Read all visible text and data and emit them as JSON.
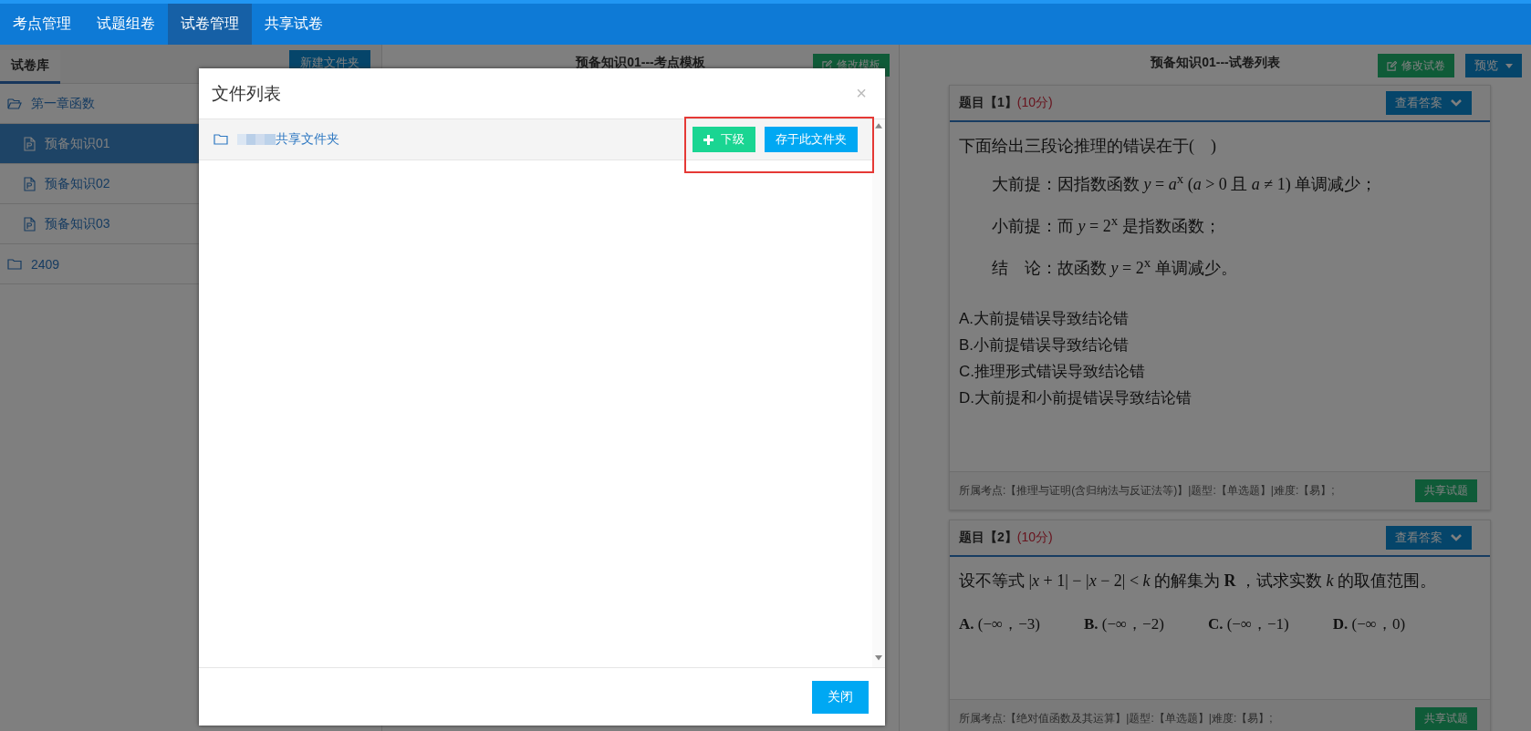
{
  "nav": {
    "tabs": [
      {
        "label": "考点管理",
        "selected": false
      },
      {
        "label": "试题组卷",
        "selected": false
      },
      {
        "label": "试卷管理",
        "selected": true
      },
      {
        "label": "共享试卷",
        "selected": false
      }
    ]
  },
  "library": {
    "tab": "试卷库",
    "new_folder_button": "新建文件夹",
    "tree": [
      {
        "label": "第一章函数",
        "kind": "folder",
        "expanded": true,
        "selected": false,
        "children": [
          {
            "label": "预备知识01",
            "kind": "file",
            "selected": true
          },
          {
            "label": "预备知识02",
            "kind": "file",
            "selected": false
          },
          {
            "label": "预备知识03",
            "kind": "file",
            "selected": false
          }
        ]
      },
      {
        "label": "2409",
        "kind": "folder",
        "expanded": false,
        "selected": false
      }
    ]
  },
  "template_panel": {
    "title": "预备知识01---考点模板",
    "edit_button": "修改模板"
  },
  "paper_panel": {
    "title": "预备知识01---试卷列表",
    "edit_button": "修改试卷",
    "preview_button": "预览",
    "questions": [
      {
        "kind": "stacked",
        "title": "题目【1】",
        "score": "(10分)",
        "answer_button": "查看答案",
        "stem": "下面给出三段论推理的错误在于(　)",
        "lines": [
          "大前提：因指数函数 *y* = *a*$^{x}$ (*a* > 0 且 *a* ≠ 1) 单调减少；",
          "小前提：而 *y* = 2$^{x}$ 是指数函数；",
          "结　论：故函数 *y* = 2$^{x}$ 单调减少。"
        ],
        "options": [
          "A.大前提错误导致结论错",
          "B.小前提错误导致结论错",
          "C.推理形式错误导致结论错",
          "D.大前提和小前提错误导致结论错"
        ],
        "info": "所属考点:【推理与证明(含归纳法与反证法等)】|题型:【单选题】|难度:【易】;",
        "share_button": "共享试题"
      },
      {
        "kind": "inline",
        "title": "题目【2】",
        "score": "(10分)",
        "answer_button": "查看答案",
        "stem": "设不等式 |*x* + 1| − |*x* − 2| < *k* 的解集为 **R** ，试求实数 *k* 的取值范围。",
        "options": [
          "**A.** (−∞，−3)",
          "**B.** (−∞，−2)",
          "**C.** (−∞，−1)",
          "**D.** (−∞，0)"
        ],
        "info": "所属考点:【绝对值函数及其运算】|题型:【单选题】|难度:【易】;",
        "share_button": "共享试题"
      }
    ]
  },
  "dialog": {
    "title": "文件列表",
    "close_icon": "×",
    "folders": [
      {
        "name": "共享文件夹",
        "redacted": true,
        "highlighted": true,
        "sub_button": "下级",
        "save_button": "存于此文件夹"
      }
    ],
    "close_button": "关闭"
  }
}
